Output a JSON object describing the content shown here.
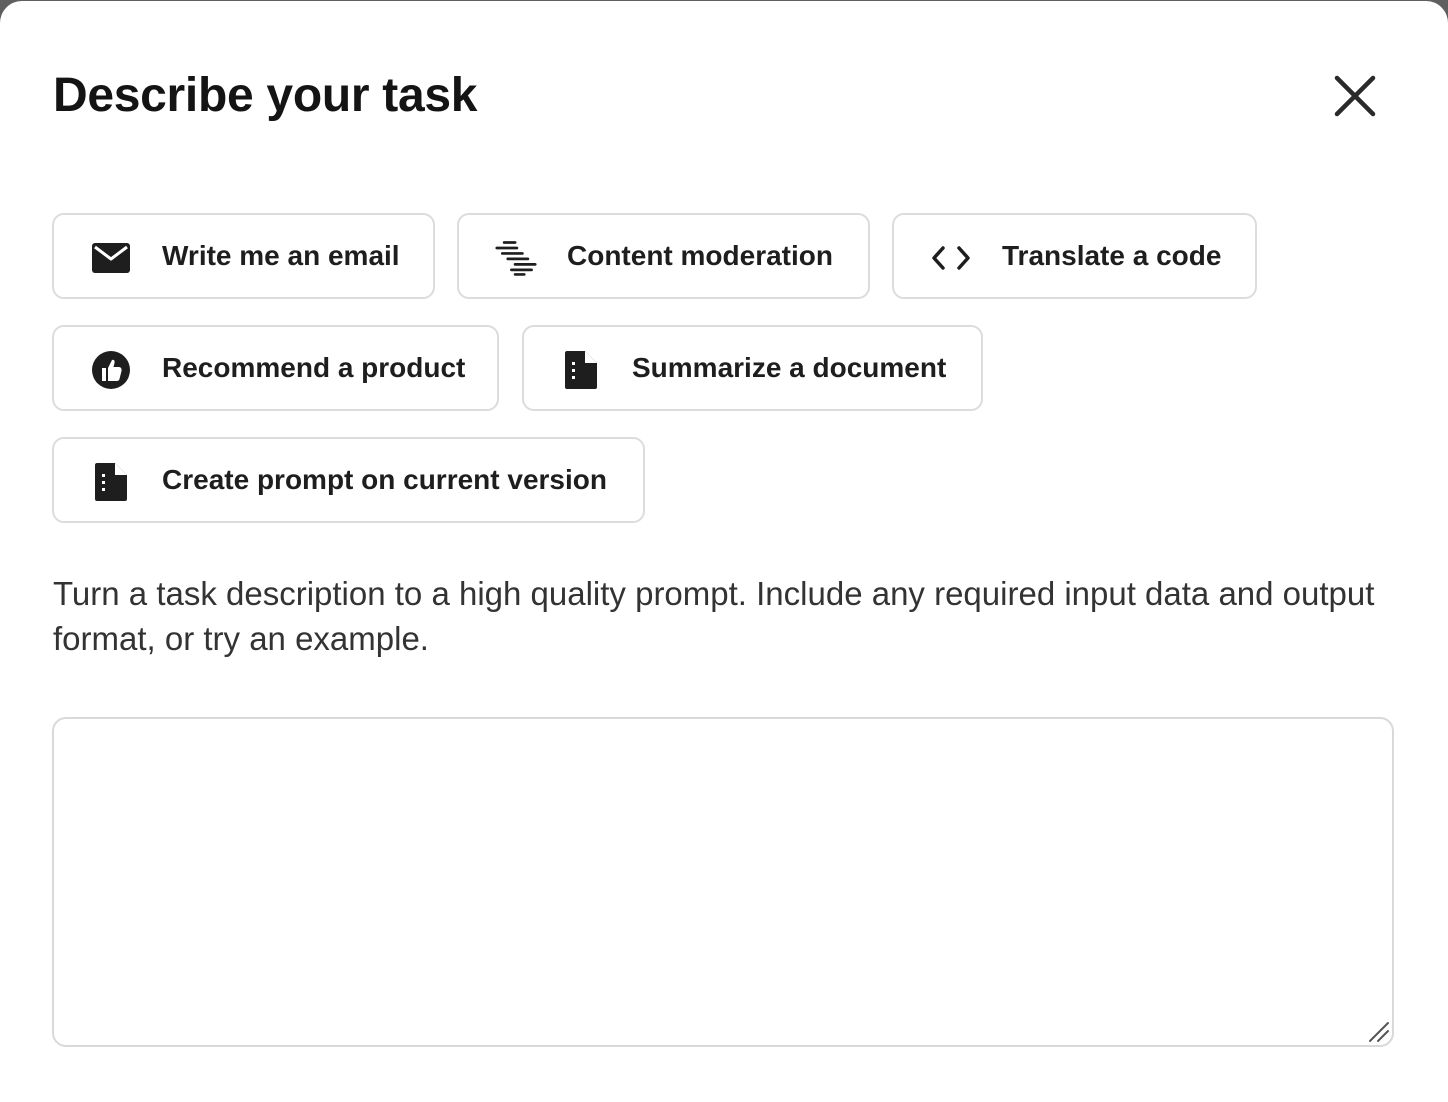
{
  "dialog": {
    "title": "Describe your task",
    "description": "Turn a task description to a high quality prompt. Include any required input data and output format, or try an example.",
    "input_value": ""
  },
  "examples": [
    {
      "label": "Write me an email",
      "icon": "envelope-icon"
    },
    {
      "label": "Content moderation",
      "icon": "stacked-lines-icon"
    },
    {
      "label": "Translate a code",
      "icon": "code-brackets-icon"
    },
    {
      "label": "Recommend a product",
      "icon": "thumbs-up-icon"
    },
    {
      "label": "Summarize a document",
      "icon": "document-icon"
    },
    {
      "label": "Create prompt on current version",
      "icon": "document-icon"
    }
  ],
  "colors": {
    "text_primary": "#141414",
    "text_secondary": "#333333",
    "border": "#dcdcdc",
    "backdrop": "#5f5f5f"
  }
}
